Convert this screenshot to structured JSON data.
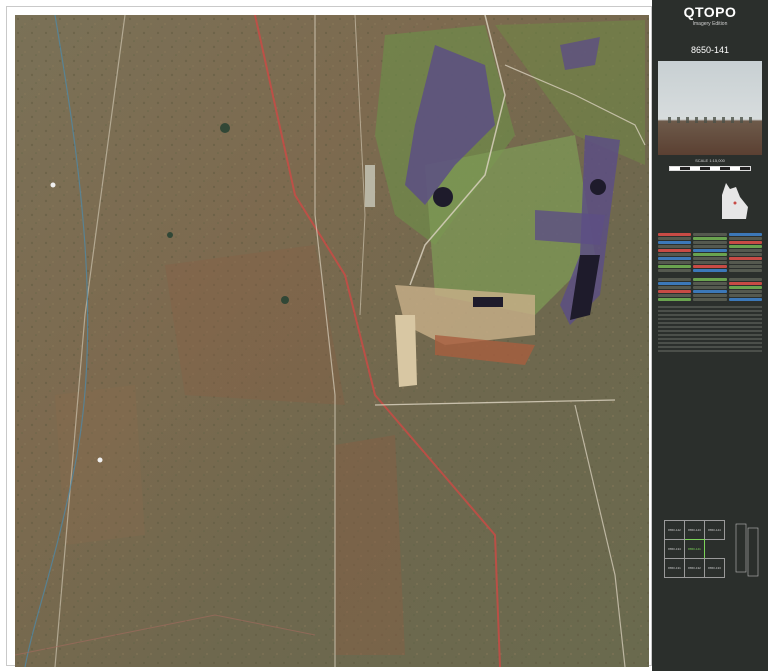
{
  "panel": {
    "brand": "QTOPO",
    "edition": "Imagery Edition",
    "sheet_number": "8650-141",
    "scale": "SCALE 1:15,000"
  },
  "colors": {
    "panel_bg": "#2b2f2c",
    "current_sheet": "#7cd35a",
    "road_red": "#c84b45",
    "water_purple": "#5c4f84"
  },
  "index_sheets": [
    "8650-142",
    "8650-143",
    "8650-144",
    "8650-141",
    "8650-134",
    "8650-131",
    "8650-132",
    "8650-133"
  ]
}
